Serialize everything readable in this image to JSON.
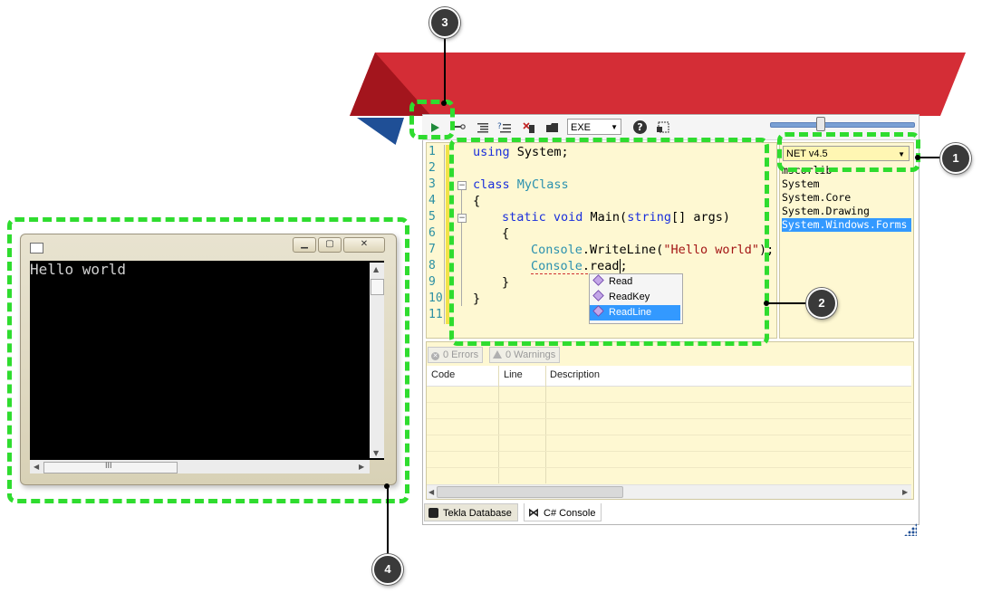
{
  "toolbar": {
    "output_type": "EXE",
    "help_label": "?"
  },
  "editor": {
    "line_numbers": [
      "1",
      "2",
      "3",
      "4",
      "5",
      "6",
      "7",
      "8",
      "9",
      "10",
      "11"
    ],
    "code": {
      "l1_kw": "using",
      "l1_rest": " System;",
      "l3_kw": "class",
      "l3_type": " MyClass",
      "l4": "{",
      "l5_kw1": "static",
      "l5_kw2": " void",
      "l5_name": " Main(",
      "l5_kw3": "string",
      "l5_rest": "[] args)",
      "l6": "{",
      "l7_type": "Console",
      "l7_method": ".WriteLine(",
      "l7_str": "\"Hello world\"",
      "l7_end": ");",
      "l8_type": "Console",
      "l8_method": ".read",
      "l8_end": ";",
      "l9": "}",
      "l10": "}"
    }
  },
  "intellisense": {
    "items": [
      "Read",
      "ReadKey",
      "ReadLine"
    ],
    "selected": "ReadLine"
  },
  "references": {
    "framework": "NET v4.5",
    "items": [
      "mscorlib",
      "System",
      "System.Core",
      "System.Drawing",
      "System.Windows.Forms"
    ]
  },
  "error_list": {
    "errors_tab": "0 Errors",
    "warnings_tab": "0 Warnings",
    "columns": [
      "Code",
      "Line",
      "Description"
    ]
  },
  "bottom_tabs": [
    "Tekla Database",
    "C# Console"
  ],
  "console_window": {
    "output": "Hello world",
    "scroll_grip": "III"
  },
  "callouts": [
    "1",
    "2",
    "3",
    "4"
  ],
  "colors": {
    "banner_red": "#d42d36",
    "banner_blue": "#1f4f96",
    "callout_green": "#2fdc2f",
    "editor_bg": "#fef8d2",
    "selection_blue": "#3399ff"
  }
}
